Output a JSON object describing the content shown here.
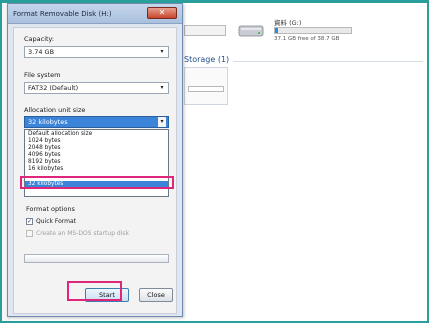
{
  "explorer": {
    "drive_g_name": "資料 (G:)",
    "drive_g_free": "37.1 GB free of 38.7 GB",
    "drive_g_used_fraction": 0.04,
    "storage_header": "Storage (1)"
  },
  "dialog": {
    "title": "Format Removable Disk (H:)",
    "close_glyph": "✕",
    "capacity_label": "Capacity:",
    "capacity_value": "3.74 GB",
    "filesystem_label": "File system",
    "filesystem_value": "FAT32 (Default)",
    "allocation_label": "Allocation unit size",
    "allocation_value": "32 kilobytes",
    "allocation_options": [
      "Default allocation size",
      "1024 bytes",
      "2048 bytes",
      "4096 bytes",
      "8192 bytes",
      "16 kilobytes",
      "32 kilobytes"
    ],
    "selected_option_index": 6,
    "format_options_label": "Format options",
    "quick_format_label": "Quick Format",
    "quick_format_checked": true,
    "msdos_label": "Create an MS-DOS startup disk",
    "msdos_checked": false,
    "start_label": "Start",
    "close_label": "Close",
    "dropdown_arrow": "▾",
    "check_mark": "✓"
  },
  "colors": {
    "frame": "#2a9e9a",
    "highlight": "#e0267a",
    "selection": "#3b84d9",
    "usage_bar": "#2a8fd6"
  }
}
